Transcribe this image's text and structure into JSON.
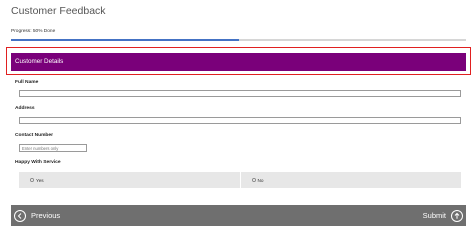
{
  "page": {
    "title": "Customer Feedback"
  },
  "progress": {
    "label": "Progress: 50% Done",
    "value": 0.5,
    "fill_color": "#4472c4"
  },
  "section": {
    "title": "Customer Details",
    "color": "#7a007a",
    "highlight_color": "#e02020"
  },
  "fields": {
    "full_name": {
      "label": "Full Name",
      "value": ""
    },
    "address": {
      "label": "Address",
      "value": ""
    },
    "contact_number": {
      "label": "Contact Number",
      "placeholder": "Enter numbers only"
    },
    "happy_with_service": {
      "label": "Happy With Service",
      "options": [
        "Yes",
        "No"
      ]
    }
  },
  "footer": {
    "previous_label": "Previous",
    "submit_label": "Submit",
    "previous_icon": "chevron-left-circle-icon",
    "submit_icon": "arrow-up-circle-icon"
  }
}
